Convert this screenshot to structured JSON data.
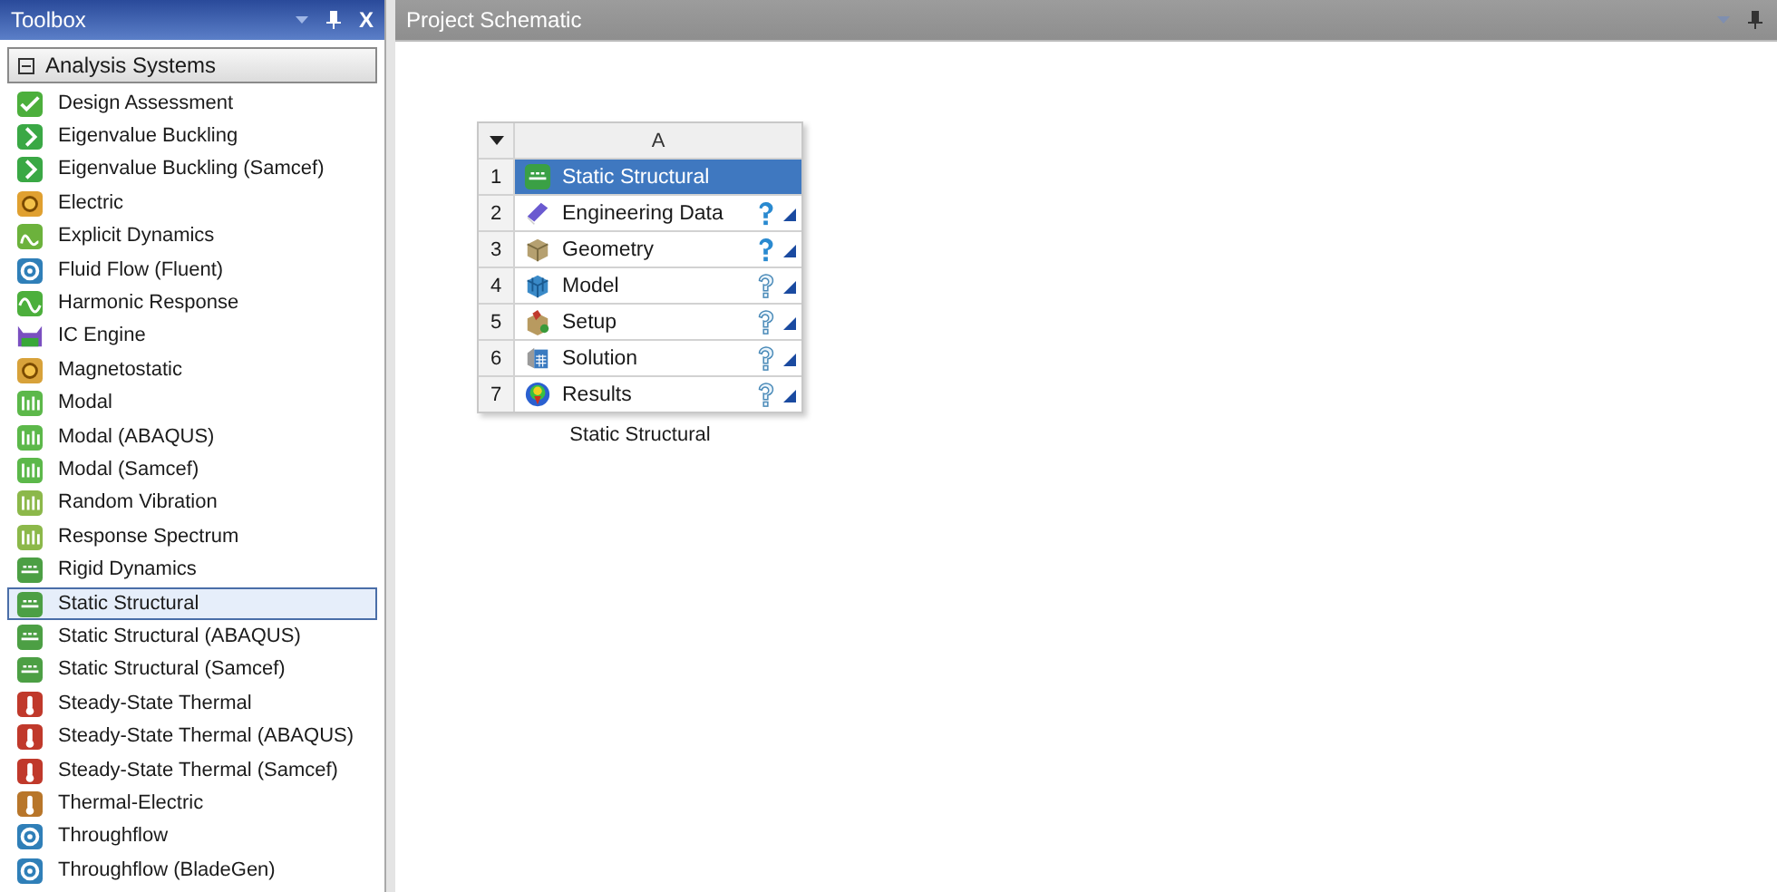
{
  "toolbox": {
    "title": "Toolbox",
    "close": "X",
    "group": {
      "label": "Analysis Systems",
      "expanded": true,
      "items": [
        {
          "label": "Design Assessment",
          "selected": false
        },
        {
          "label": "Eigenvalue Buckling",
          "selected": false
        },
        {
          "label": "Eigenvalue Buckling (Samcef)",
          "selected": false
        },
        {
          "label": "Electric",
          "selected": false
        },
        {
          "label": "Explicit Dynamics",
          "selected": false
        },
        {
          "label": "Fluid Flow (Fluent)",
          "selected": false
        },
        {
          "label": "Harmonic Response",
          "selected": false
        },
        {
          "label": "IC Engine",
          "selected": false
        },
        {
          "label": "Magnetostatic",
          "selected": false
        },
        {
          "label": "Modal",
          "selected": false
        },
        {
          "label": "Modal (ABAQUS)",
          "selected": false
        },
        {
          "label": "Modal (Samcef)",
          "selected": false
        },
        {
          "label": "Random Vibration",
          "selected": false
        },
        {
          "label": "Response Spectrum",
          "selected": false
        },
        {
          "label": "Rigid Dynamics",
          "selected": false
        },
        {
          "label": "Static Structural",
          "selected": true
        },
        {
          "label": "Static Structural (ABAQUS)",
          "selected": false
        },
        {
          "label": "Static Structural (Samcef)",
          "selected": false
        },
        {
          "label": "Steady-State Thermal",
          "selected": false
        },
        {
          "label": "Steady-State Thermal (ABAQUS)",
          "selected": false
        },
        {
          "label": "Steady-State Thermal (Samcef)",
          "selected": false
        },
        {
          "label": "Thermal-Electric",
          "selected": false
        },
        {
          "label": "Throughflow",
          "selected": false
        },
        {
          "label": "Throughflow (BladeGen)",
          "selected": false
        }
      ]
    }
  },
  "schematic": {
    "title": "Project Schematic",
    "system": {
      "column": "A",
      "caption": "Static Structural",
      "rows": [
        {
          "number": "1",
          "label": "Static Structural",
          "selected": true,
          "kind": "plain"
        },
        {
          "number": "2",
          "label": "Engineering Data",
          "selected": false,
          "kind": "attention"
        },
        {
          "number": "3",
          "label": "Geometry",
          "selected": false,
          "kind": "attention"
        },
        {
          "number": "4",
          "label": "Model",
          "selected": false,
          "kind": "waiting"
        },
        {
          "number": "5",
          "label": "Setup",
          "selected": false,
          "kind": "waiting"
        },
        {
          "number": "6",
          "label": "Solution",
          "selected": false,
          "kind": "waiting"
        },
        {
          "number": "7",
          "label": "Results",
          "selected": false,
          "kind": "waiting"
        }
      ]
    }
  }
}
